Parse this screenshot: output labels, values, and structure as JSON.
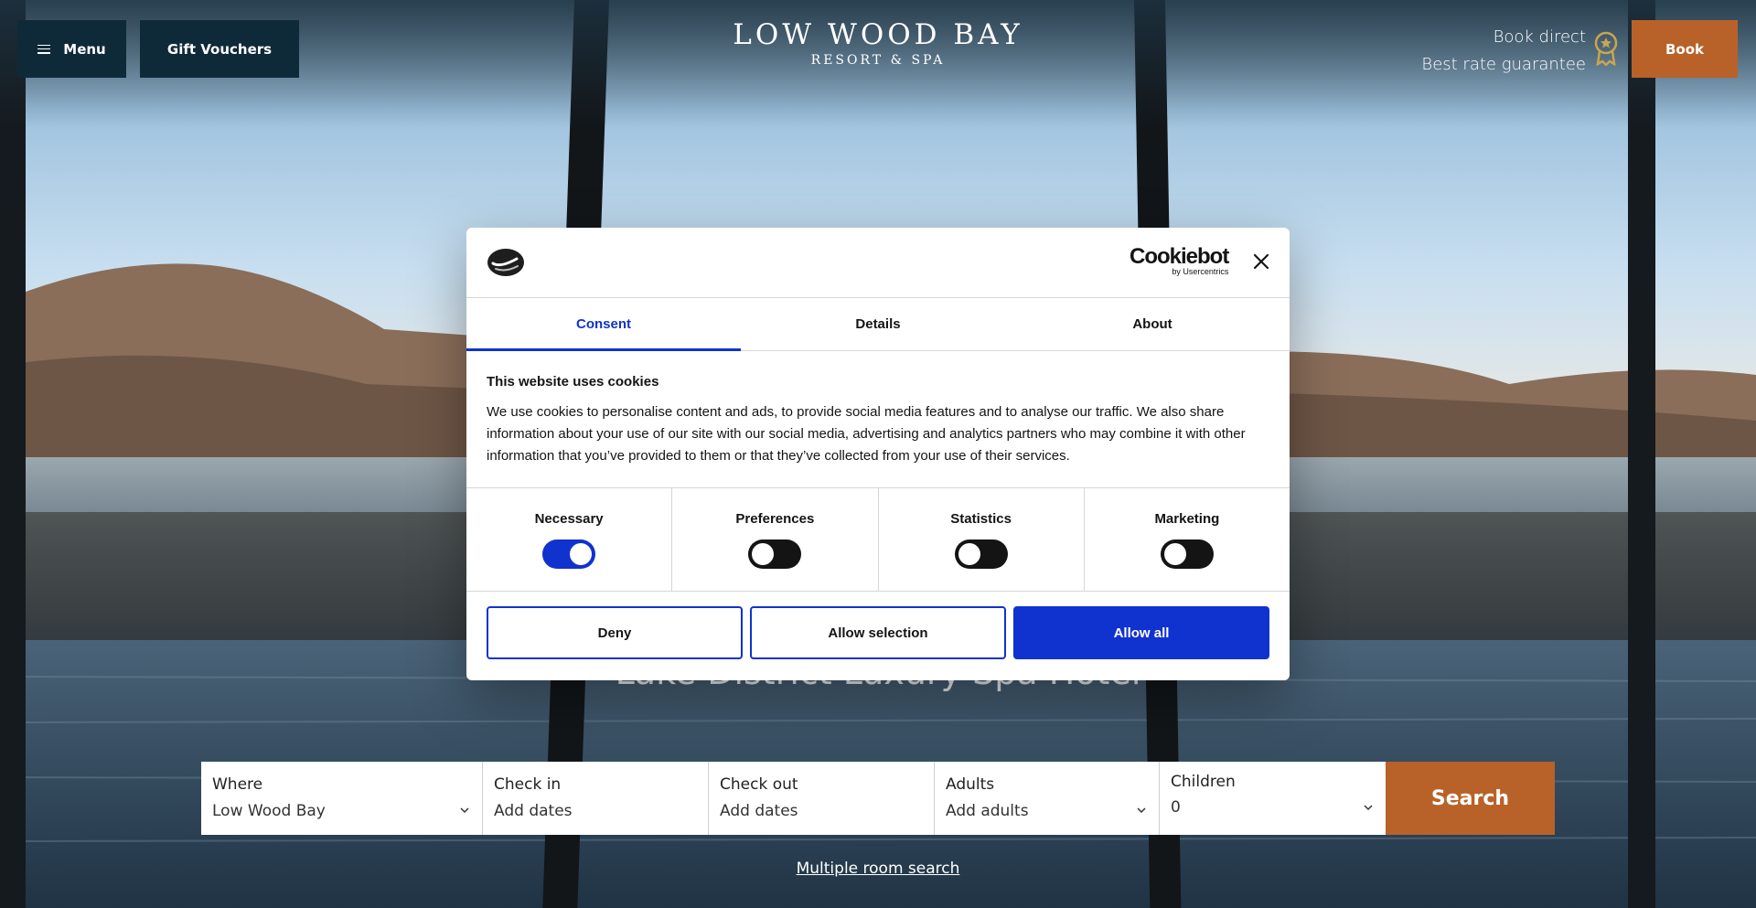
{
  "header": {
    "menu_label": "Menu",
    "gift_label": "Gift Vouchers",
    "logo_line1": "LOW WOOD BAY",
    "logo_line2": "RESORT & SPA",
    "book_direct_line1": "Book direct",
    "book_direct_line2": "Best rate guarantee",
    "book_label": "Book",
    "icons": [
      "menu-icon",
      "award-icon"
    ],
    "colors": {
      "dark_button": "#0e2a38",
      "accent": "#b8622a"
    }
  },
  "hero": {
    "tagline": "Lake District Luxury Spa Hotel"
  },
  "booking": {
    "where": {
      "label": "Where",
      "value": "Low Wood Bay"
    },
    "check_in": {
      "label": "Check in",
      "value": "Add dates"
    },
    "check_out": {
      "label": "Check out",
      "value": "Add dates"
    },
    "adults": {
      "label": "Adults",
      "value": "Add adults"
    },
    "children": {
      "label": "Children",
      "value": "0"
    },
    "search_label": "Search",
    "multi_room_label": "Multiple room search"
  },
  "cookie_dialog": {
    "brand": "Cookiebot",
    "brand_sub": "by Usercentrics",
    "tabs": [
      {
        "label": "Consent",
        "active": true
      },
      {
        "label": "Details",
        "active": false
      },
      {
        "label": "About",
        "active": false
      }
    ],
    "heading": "This website uses cookies",
    "body": "We use cookies to personalise content and ads, to provide social media features and to analyse our traffic. We also share information about your use of our site with our social media, advertising and analytics partners who may combine it with other information that you’ve provided to them or that they’ve collected from your use of their services.",
    "toggles": [
      {
        "label": "Necessary",
        "on": true
      },
      {
        "label": "Preferences",
        "on": false
      },
      {
        "label": "Statistics",
        "on": false
      },
      {
        "label": "Marketing",
        "on": false
      }
    ],
    "buttons": {
      "deny": "Deny",
      "allow_selection": "Allow selection",
      "allow_all": "Allow all"
    },
    "colors": {
      "primary": "#1032cf",
      "text": "#141414"
    }
  }
}
